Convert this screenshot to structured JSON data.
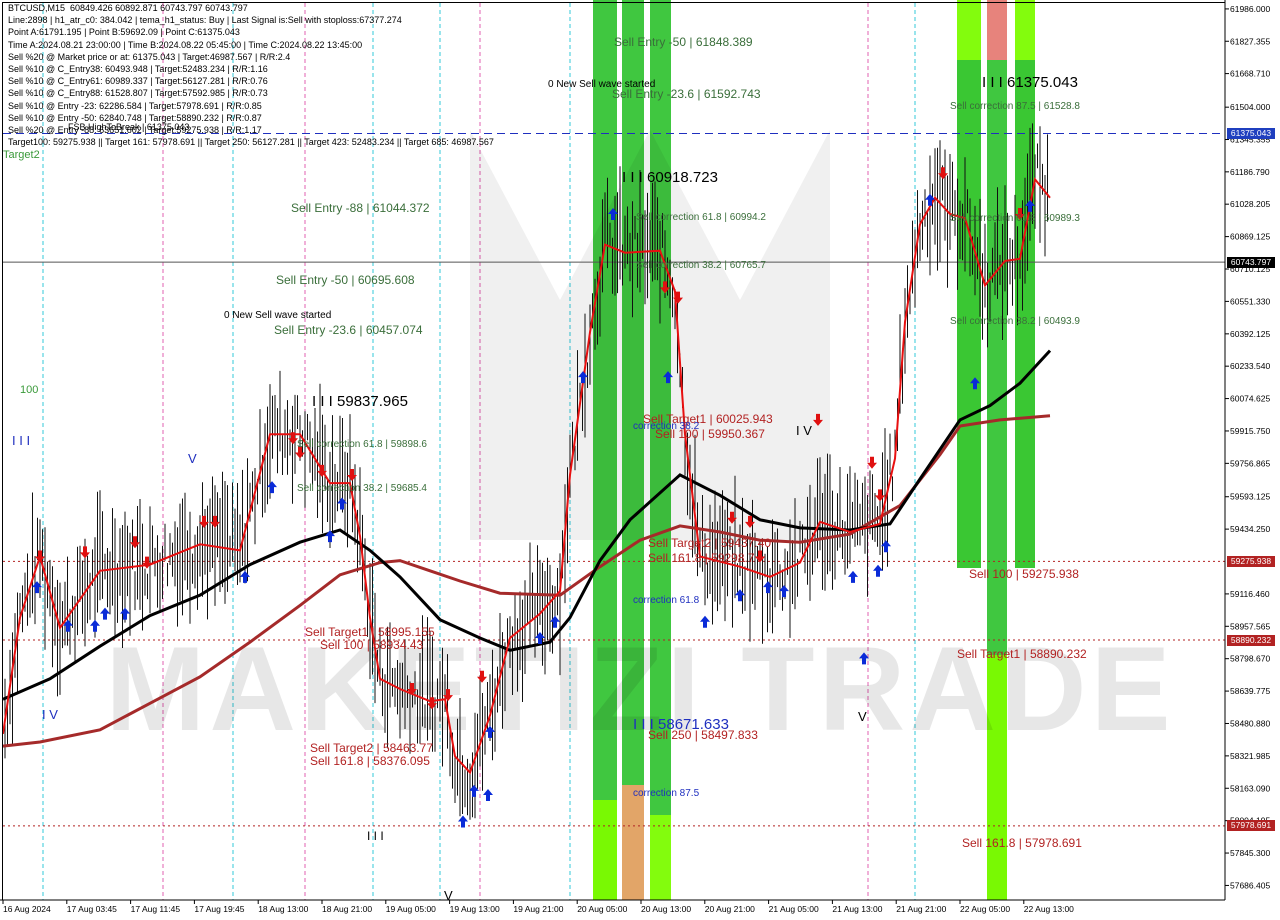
{
  "chart_data": {
    "type": "candlestick",
    "symbol_timeframe": "BTCUSD,M15",
    "ohlc_header": "60849.426 60892.871 60743.797 60743.797",
    "info_lines": [
      "Line:2898 | h1_atr_c0: 384.042 | tema_h1_status: Buy | Last Signal is:Sell with stoploss:67377.274",
      "Point A:61791.195 | Point B:59692.09 | Point C:61375.043",
      "Time A:2024.08.21 23:00:00 | Time B:2024.08.22 05:45:00 | Time C:2024.08.22 13:45:00",
      "Sell %20 @ Market price or at: 61375.043 | Target:46987.567 | R/R:2.4",
      "Sell %10 @ C_Entry38: 60493.948 | Target:52483.234 | R/R:1.16",
      "Sell %10 @ C_Entry61: 60989.337 | Target:56127.281 | R/R:0.76",
      "Sell %10 @ C_Entry88: 61528.807 | Target:57592.985 | R/R:0.73",
      "Sell %10 @ Entry -23: 62286.584 | Target:57978.691 | R/R:0.85",
      "Sell %10 @ Entry -50: 62840.748 | Target:58890.232 | R/R:0.87",
      "Sell %20 @ Entry -88: 63651.602 | Target:59275.938 | R/R:1.17",
      "Target100: 59275.938 || Target 161: 57978.691 || Target 250: 56127.281 || Target 423: 52483.234 || Target 685: 46987.567"
    ],
    "y_ticks": [
      "61986.000",
      "61827.355",
      "61668.710",
      "61504.000",
      "61345.355",
      "61186.790",
      "61028.205",
      "60869.125",
      "60710.125",
      "60551.330",
      "60392.125",
      "60233.540",
      "60074.625",
      "59915.750",
      "59756.865",
      "59593.125",
      "59434.250",
      "59116.460",
      "58957.565",
      "58798.670",
      "58639.775",
      "58480.880",
      "58321.985",
      "58163.090",
      "58004.195",
      "57845.300",
      "57686.405"
    ],
    "x_ticks": [
      "16 Aug 2024",
      "17 Aug 03:45",
      "17 Aug 11:45",
      "17 Aug 19:45",
      "18 Aug 13:00",
      "18 Aug 21:00",
      "19 Aug 05:00",
      "19 Aug 13:00",
      "19 Aug 21:00",
      "20 Aug 05:00",
      "20 Aug 13:00",
      "20 Aug 21:00",
      "21 Aug 05:00",
      "21 Aug 13:00",
      "21 Aug 21:00",
      "22 Aug 05:00",
      "22 Aug 13:00"
    ],
    "ylim": [
      57615,
      62015
    ],
    "price_tags": [
      {
        "label": "61375.043",
        "value": 61375.043,
        "color": "#1f3fbf"
      },
      {
        "label": "60743.797",
        "value": 60743.797,
        "color": "#000000"
      },
      {
        "label": "59275.938",
        "value": 59275.938,
        "color": "#b22222"
      },
      {
        "label": "58890.232",
        "value": 58890.232,
        "color": "#b22222"
      },
      {
        "label": "57978.691",
        "value": 57978.691,
        "color": "#b22222"
      }
    ],
    "horizontal_levels": [
      {
        "value": 61375.043,
        "color": "#1f2fbf",
        "style": "dash"
      },
      {
        "value": 60743.797,
        "color": "#555555",
        "style": "solid"
      },
      {
        "value": 59275.938,
        "color": "#b22222",
        "style": "dot"
      },
      {
        "value": 58890.232,
        "color": "#b22222",
        "style": "dot"
      },
      {
        "value": 57978.691,
        "color": "#b22222",
        "style": "dot"
      }
    ],
    "annotations": [
      {
        "text": "Sell Entry -50 | 61848.389",
        "color": "#3a6e3a",
        "size": 12
      },
      {
        "text": "0 New Sell wave started",
        "color": "#000000",
        "size": 10
      },
      {
        "text": "Sell Entry -23.6 | 61592.743",
        "color": "#3a6e3a",
        "size": 12
      },
      {
        "text": "I I I 61375.043",
        "color": "#000000",
        "size": 15
      },
      {
        "text": "Sell correction 87.5 | 61528.8",
        "color": "#3a6e3a",
        "size": 10
      },
      {
        "text": "I I I 60918.723",
        "color": "#000000",
        "size": 15
      },
      {
        "text": "Sell correction 61.8 | 60994.2",
        "color": "#3a6e3a",
        "size": 10
      },
      {
        "text": "Sell correction 61.8 | 60989.3",
        "color": "#3a6e3a",
        "size": 10
      },
      {
        "text": "Sell Entry -88 | 61044.372",
        "color": "#3a6e3a",
        "size": 12
      },
      {
        "text": "Sell correction 38.2 | 60765.7",
        "color": "#3a6e3a",
        "size": 10
      },
      {
        "text": "Sell Entry -50 | 60695.608",
        "color": "#3a6e3a",
        "size": 12
      },
      {
        "text": "0 New Sell wave started",
        "color": "#000000",
        "size": 10
      },
      {
        "text": "Sell Entry -23.6 | 60457.074",
        "color": "#3a6e3a",
        "size": 12
      },
      {
        "text": "Sell correction 38.2 | 60493.9",
        "color": "#3a6e3a",
        "size": 10
      },
      {
        "text": "I I I 59837.965",
        "color": "#000000",
        "size": 15
      },
      {
        "text": "Sell Target1 | 60025.943",
        "color": "#b22222",
        "size": 12
      },
      {
        "text": "correction 38.2",
        "color": "#1f2fbf",
        "size": 10
      },
      {
        "text": "Sell 100 | 59950.367",
        "color": "#b22222",
        "size": 12
      },
      {
        "text": "I V",
        "color": "#000000",
        "size": 13
      },
      {
        "text": "Sell correction 61.8 | 59898.6",
        "color": "#3a6e3a",
        "size": 10
      },
      {
        "text": "Sell correction 38.2 | 59685.4",
        "color": "#3a6e3a",
        "size": 10
      },
      {
        "text": "Sell Target2 | 59437.40",
        "color": "#b22222",
        "size": 12
      },
      {
        "text": "Sell 161.8 | 59298.7",
        "color": "#b22222",
        "size": 12
      },
      {
        "text": "Sell 100 | 59275.938",
        "color": "#b22222",
        "size": 12
      },
      {
        "text": "correction 61.8",
        "color": "#1f2fbf",
        "size": 10
      },
      {
        "text": "Sell Target1 | 58995.155",
        "color": "#b22222",
        "size": 12
      },
      {
        "text": "Sell 100 | 58934.43",
        "color": "#b22222",
        "size": 12
      },
      {
        "text": "Sell Target1 | 58890.232",
        "color": "#b22222",
        "size": 12
      },
      {
        "text": "I I I 58671.633",
        "color": "#1f2fbf",
        "size": 15
      },
      {
        "text": "Sell 250 | 58497.833",
        "color": "#b22222",
        "size": 12
      },
      {
        "text": "Sell Target2 | 58463.77",
        "color": "#b22222",
        "size": 12
      },
      {
        "text": "Sell 161.8 | 58376.095",
        "color": "#b22222",
        "size": 12
      },
      {
        "text": "correction 87.5",
        "color": "#1f2fbf",
        "size": 10
      },
      {
        "text": "Sell 161.8 | 57978.691",
        "color": "#b22222",
        "size": 12
      },
      {
        "text": "I I I",
        "color": "#000000",
        "size": 12
      },
      {
        "text": "V",
        "color": "#000000",
        "size": 13
      },
      {
        "text": "V",
        "color": "#000000",
        "size": 13
      },
      {
        "text": "I V",
        "color": "#1f2fbf",
        "size": 13
      },
      {
        "text": "I I I",
        "color": "#1f2fbf",
        "size": 13
      },
      {
        "text": "V",
        "color": "#1f2fbf",
        "size": 13
      },
      {
        "text": "100",
        "color": "#3a9a3a",
        "size": 11
      },
      {
        "text": "Target2",
        "color": "#3a9a3a",
        "size": 11
      },
      {
        "text": "FSB HighToBreak | 61375.043",
        "color": "#000000",
        "size": 9
      }
    ],
    "watermark": "MAKETIZI TRADE"
  },
  "colors": {
    "bull_arrow": "#0a2bd8",
    "bear_arrow": "#e01010",
    "ema_fast": "#e81010",
    "ema_mid": "#000000",
    "ema_slow": "#a52a2a",
    "zone_green": "#36c436",
    "zone_lime": "#7cfc00",
    "zone_red": "#f08080",
    "zone_orange": "#e0a060"
  }
}
